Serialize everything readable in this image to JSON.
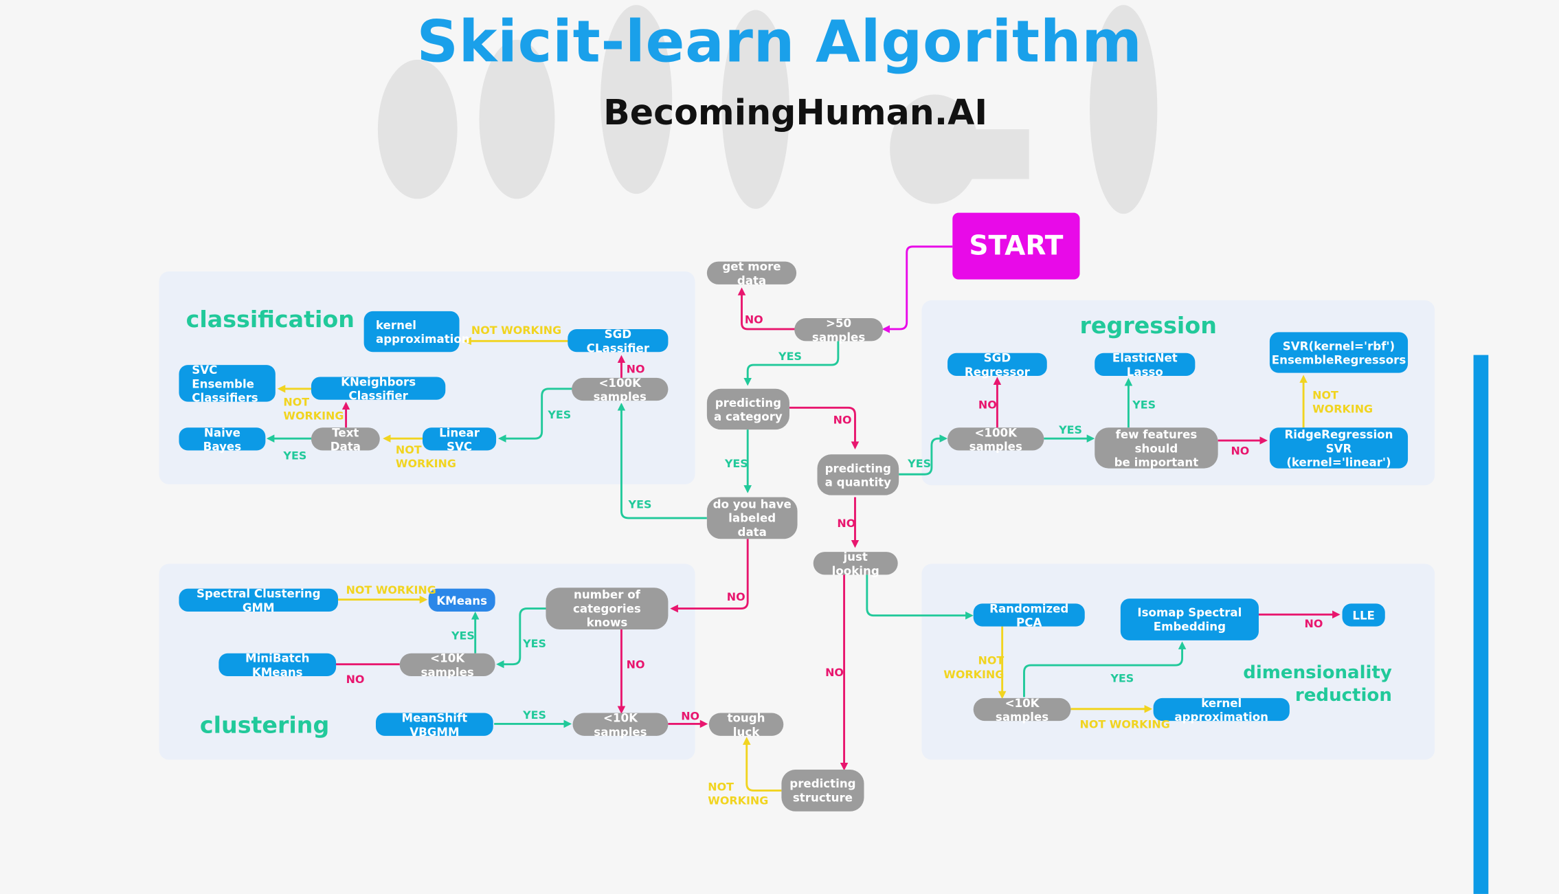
{
  "header": {
    "title": "Skicit-learn Algorithm",
    "subtitle": "BecomingHuman.AI"
  },
  "sections": {
    "classification": "classification",
    "regression": "regression",
    "clustering": "clustering",
    "dimensionality": "dimensionality\nreduction"
  },
  "nodes": {
    "start": "START",
    "get_more_data": "get more data",
    "gt50": ">50 samples",
    "pred_category": "predicting\na category",
    "pred_quantity": "predicting\na quantity",
    "labeled": "do you have\nlabeled data",
    "just_looking": "just looking",
    "num_cats": "number of\ncategories knows",
    "tough_luck": "tough luck",
    "pred_structure": "predicting\nstructure",
    "lt100k_class": "<100K samples",
    "sgd_classifier": "SGD CLassifier",
    "kernel_approx_class": "kernel\napproximation",
    "linear_svc": "Linear SVC",
    "text_data": "Text Data",
    "kneighbors": "KNeighbors Classifier",
    "svc_ensemble": "SVC Ensemble\nClassifiers",
    "naive_bayes": "Naive Bayes",
    "lt100k_reg": "<100K samples",
    "sgd_regressor": "SGD Regressor",
    "few_features": "few features should\nbe important",
    "elasticnet": "ElasticNet Lasso",
    "ridge": "RidgeRegression SVR\n(kernel='linear')",
    "svr_rbf": "SVR(kernel='rbf')\nEnsembleRegressors",
    "spectral_gmm": "Spectral Clustering GMM",
    "kmeans": "KMeans",
    "lt10k_clust": "<10K samples",
    "minibatch": "MiniBatch KMeans",
    "meanshift": "MeanShift VBGMM",
    "lt10k_clust2": "<10K samples",
    "randomized_pca": "Randomized PCA",
    "isomap": "Isomap Spectral\nEmbedding",
    "lle": "LLE",
    "lt10k_dim": "<10K samples",
    "kernel_approx_dim": "kernel approximation"
  },
  "edge_labels": {
    "yes": "YES",
    "no": "NO",
    "not_working": "NOT WORKING",
    "not_working_2line": "NOT\nWORKING"
  },
  "colors": {
    "yes": "#21c99a",
    "no": "#e8166e",
    "not_working": "#f1d420",
    "start": "#e80ae8",
    "accent": "#0c9ae6"
  }
}
